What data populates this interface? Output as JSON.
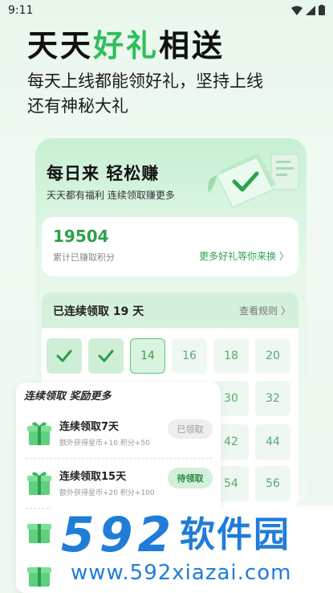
{
  "status": {
    "time": "9:11"
  },
  "hero": {
    "title_a": "天天",
    "title_highlight": "好礼",
    "title_b": "相送",
    "subtitle_line1": "每天上线都能领好礼，坚持上线",
    "subtitle_line2": "还有神秘大礼"
  },
  "card": {
    "title": "每日来 轻松赚",
    "subtitle": "天天都有福利 连续领取赚更多"
  },
  "points": {
    "value": "19504",
    "label": "累计已赚取积分",
    "link": "更多好礼等你来换 〉"
  },
  "streak": {
    "label": "已连续领取 19 天",
    "rules_link": "查看规则 〉",
    "days": [
      {
        "label": "",
        "state": "done"
      },
      {
        "label": "",
        "state": "done"
      },
      {
        "label": "14",
        "state": "today"
      },
      {
        "label": "16",
        "state": "future"
      },
      {
        "label": "18",
        "state": "future"
      },
      {
        "label": "20",
        "state": "future"
      },
      {
        "label": "30",
        "state": "future"
      },
      {
        "label": "32",
        "state": "future"
      },
      {
        "label": "42",
        "state": "future"
      },
      {
        "label": "44",
        "state": "future"
      },
      {
        "label": "54",
        "state": "future"
      },
      {
        "label": "56",
        "state": "future"
      }
    ]
  },
  "rewards": {
    "title": "连续领取 奖励更多",
    "items": [
      {
        "name": "连续领取7天",
        "detail": "额外获得星币+10 积分+50",
        "button": "已领取",
        "claimed": true
      },
      {
        "name": "连续领取15天",
        "detail": "额外获得星币+20 积分+100",
        "button": "待领取",
        "claimed": false
      }
    ]
  },
  "watermark": {
    "logo_num": "592",
    "logo_cn": "软件园",
    "url": "www.592xiazai.com"
  },
  "colors": {
    "accent": "#2fbe5b",
    "brand_watermark": "#1f7dd8"
  }
}
